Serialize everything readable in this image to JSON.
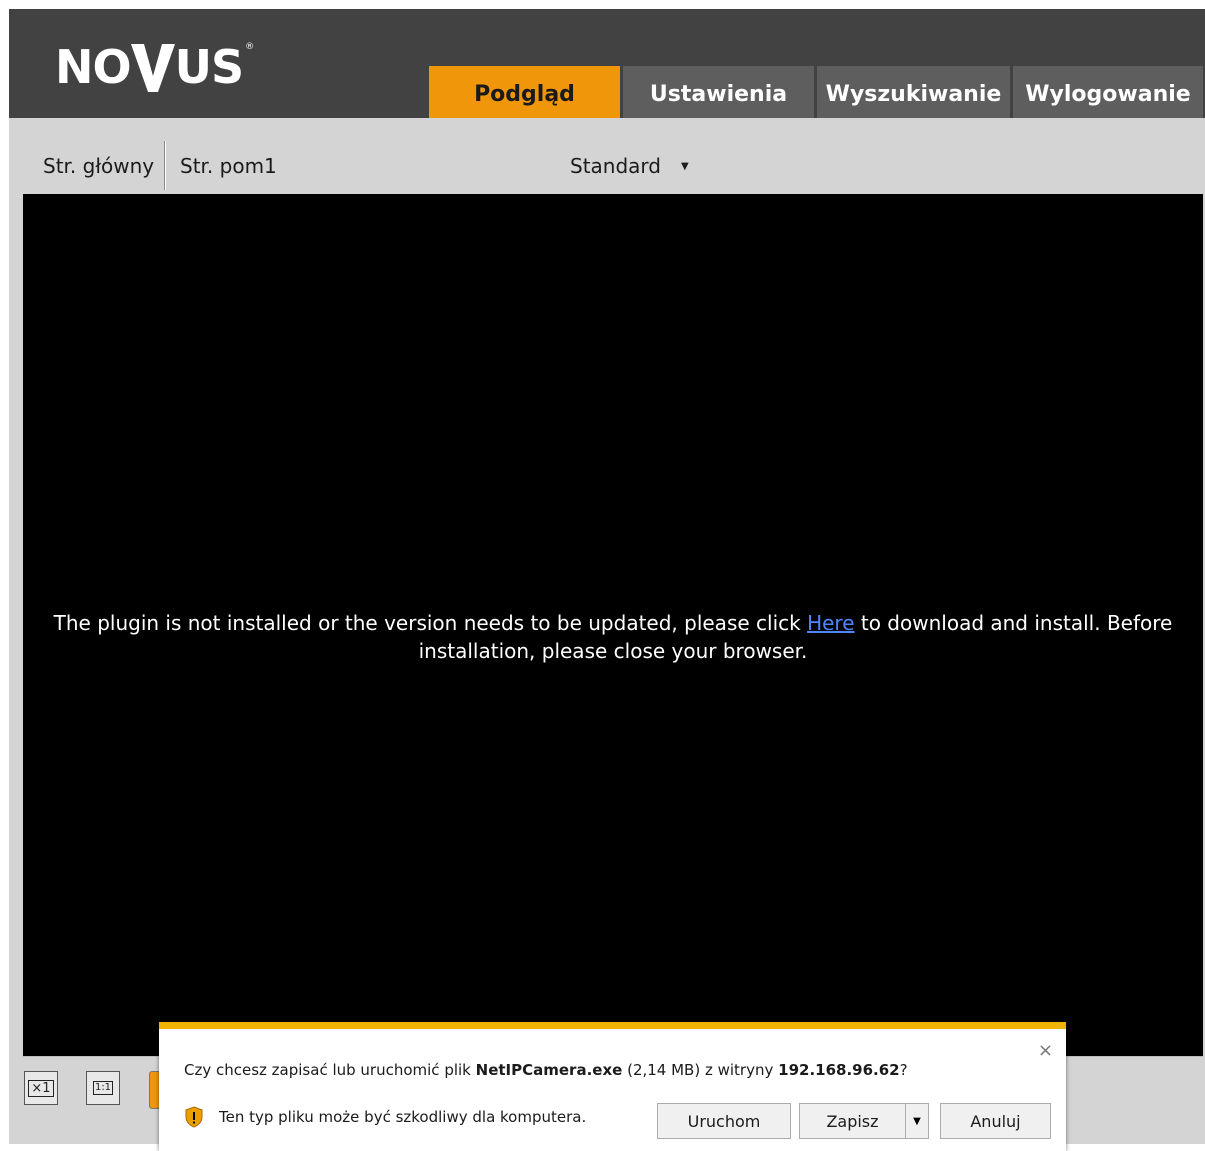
{
  "brand": {
    "logo_text_left": "NO",
    "logo_text_right": "US",
    "logo_reg": "®",
    "logo_icon": "v-chevron-icon"
  },
  "tabs": [
    {
      "label": "Podgląd",
      "active": true
    },
    {
      "label": "Ustawienia",
      "active": false
    },
    {
      "label": "Wyszukiwanie",
      "active": false
    },
    {
      "label": "Wylogowanie",
      "active": false
    }
  ],
  "streams": {
    "main": "Str. główny",
    "sub": "Str. pom1"
  },
  "view_mode": {
    "selected": "Standard",
    "icon": "caret-down-icon"
  },
  "viewer": {
    "message_before": "The plugin is not installed or the version needs to be updated, please click",
    "link_text": "Here",
    "message_after": "to download and install. Before installation, please close your browser."
  },
  "controls": {
    "icons": [
      "original-size-x1-icon",
      "fit-1-1-icon",
      "orange-control-icon"
    ],
    "x1_label": "×1",
    "ratio_label": "1:1"
  },
  "download_bar": {
    "question_prefix": "Czy chcesz zapisać lub uruchomić plik",
    "file_name": "NetIPCamera.exe",
    "file_size": "(2,14 MB) z witryny",
    "site": "192.168.96.62",
    "question_suffix": "?",
    "warning": "Ten typ pliku może być szkodliwy dla komputera.",
    "run_label": "Uruchom",
    "save_label": "Zapisz",
    "cancel_label": "Anuluj",
    "close_glyph": "×",
    "split_glyph": "▼"
  },
  "colors": {
    "header": "#424242",
    "tab_active": "#f0960a",
    "tab": "#5e5e5e",
    "toolbar": "#d4d4d4",
    "viewer": "#000000",
    "link": "#4f86ff",
    "dialog_accent": "#f0b400"
  }
}
